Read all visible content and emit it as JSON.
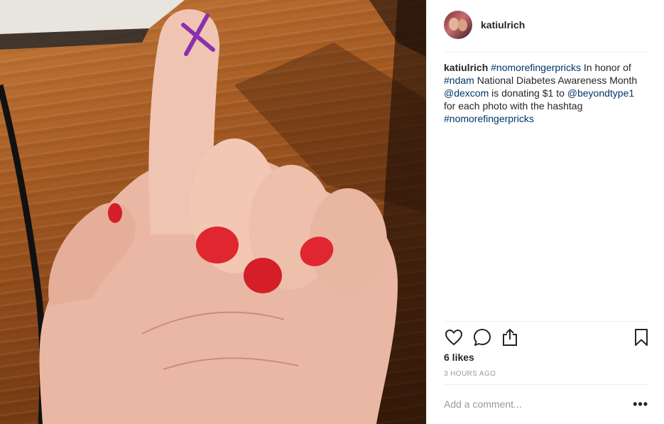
{
  "post": {
    "author": "katiulrich",
    "avatar_icon": "user-avatar",
    "photo_description_icon": "hand-photo",
    "caption": {
      "user": "katiulrich",
      "segments": [
        {
          "type": "link",
          "text": "#nomorefingerpricks"
        },
        {
          "type": "text",
          "text": " In honor of "
        },
        {
          "type": "link",
          "text": "#ndam"
        },
        {
          "type": "text",
          "text": " National Diabetes Awareness Month "
        },
        {
          "type": "link",
          "text": "@dexcom"
        },
        {
          "type": "text",
          "text": " is donating $1 to "
        },
        {
          "type": "link",
          "text": "@beyondtype1"
        },
        {
          "type": "text",
          "text": " for each photo with the hashtag "
        },
        {
          "type": "link",
          "text": "#nomorefingerpricks"
        }
      ]
    },
    "actions": {
      "like_icon": "heart-icon",
      "comment_icon": "comment-icon",
      "share_icon": "share-icon",
      "save_icon": "bookmark-icon"
    },
    "likes": "6 likes",
    "timestamp": "3 HOURS AGO",
    "comment_placeholder": "Add a comment...",
    "more_label": "•••"
  },
  "colors": {
    "link": "#003569",
    "text": "#262626",
    "muted": "#999999",
    "nail": "#e0262e",
    "marker_x": "#8a2fb0"
  }
}
